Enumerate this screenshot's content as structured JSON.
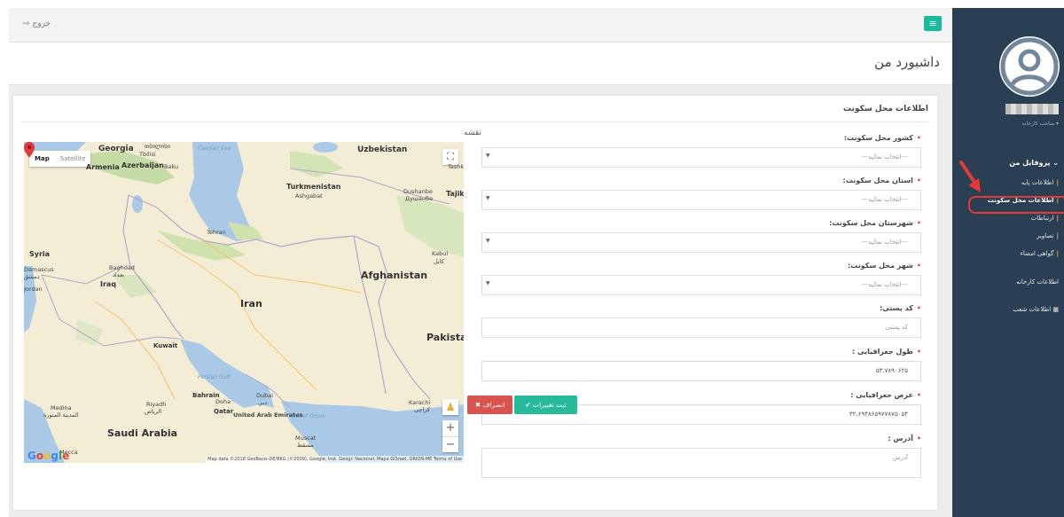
{
  "header": {
    "logout_label": "خروج",
    "logout_icon": "sign-out-icon",
    "menu_icon": "hamburger-icon"
  },
  "page": {
    "title": "داشبورد من"
  },
  "panel": {
    "title": "اطلاعات محل سکونت",
    "map_label": "نقشه"
  },
  "map": {
    "type_map": "Map",
    "type_satellite": "Satellite",
    "countries": [
      "Uzbekistan",
      "Georgia",
      "Armenia",
      "Azerbaijan",
      "Turkmenistan",
      "Tajik",
      "Syria",
      "Iraq",
      "Iran",
      "Afghanistan",
      "Pakistan",
      "Saudi Arabia",
      "Kuwait",
      "Bahrain",
      "Qatar",
      "United Arab Emirates",
      "Damascus",
      "Jordan"
    ],
    "cities": [
      "Tbilisi",
      "Baku",
      "Ashgabat",
      "Dushanbe",
      "Tashk",
      "Tehran",
      "Baghdad",
      "Kabul",
      "Riyadh",
      "Medina",
      "Doha",
      "Dubai",
      "Karachi",
      "Muscat",
      "Mecca",
      "Persian Gulf",
      "Gulf of Oman",
      "Caspian Sea"
    ],
    "damascus_ar": "دمشق",
    "medina_ar": "المدينة المنورة",
    "riyadh_ar": "الرياض",
    "baghdad_ar": "بغداد",
    "kabul_ar": "کابل",
    "dubai_ar": "دبي",
    "muscat_ar": "مسقط",
    "karachi_ar": "کراچی",
    "tbilisi_ge": "თბილისი",
    "dushanbe_ru": "Душанбе",
    "attribution": "Map data ©2018 GeoBasis-DE/BKG (©2009), Google, Inst. Geogr. Nacional, Mapa GISrael, ORION-ME   Terms of Use",
    "google": "Google",
    "marker_color": "#e53935"
  },
  "form": {
    "fields": [
      {
        "label": "کشور محل سکونت:",
        "value": "---انتخاب نمائید---",
        "type": "select"
      },
      {
        "label": "استان محل سکونت:",
        "value": "---انتخاب نمائید---",
        "type": "select"
      },
      {
        "label": "شهرستان محل سکونت:",
        "value": "---انتخاب نمائید---",
        "type": "select"
      },
      {
        "label": "شهر محل سکونت:",
        "value": "---انتخاب نمائید---",
        "type": "select"
      },
      {
        "label": "کد پستی:",
        "value": "کد پستی",
        "type": "input"
      },
      {
        "label": "طول جغرافیایی :",
        "value": "۵۳.۷۸۹۰۶۲۵",
        "type": "input"
      },
      {
        "label": "عرض جغرافیایی :",
        "value": "۳۲.۶۹۴۸۶۵۹۷۷۸۷۵۰۵۴",
        "type": "input"
      },
      {
        "label": "آدرس :",
        "value": "آدرس",
        "type": "textarea"
      }
    ],
    "save_label": "ثبت تغییرات",
    "cancel_label": "انصراف"
  },
  "sidebar": {
    "user_role": "صاحب کارخانه",
    "profile_heading": "پروفایل من",
    "items": [
      {
        "label": "اطلاعات پایه"
      },
      {
        "label": "اطلاعات محل سکونت"
      },
      {
        "label": "ارتباطات"
      },
      {
        "label": "تصاویر"
      },
      {
        "label": "گواهی امضاء"
      }
    ],
    "factory_info": "اطلاعات کارخانه",
    "branches_info": "اطلاعات شعب"
  },
  "colors": {
    "accent": "#1abb9c",
    "sidebar_bg": "#2a3f54",
    "save": "#26b99a",
    "cancel": "#d9534f",
    "highlight": "#e53935"
  }
}
